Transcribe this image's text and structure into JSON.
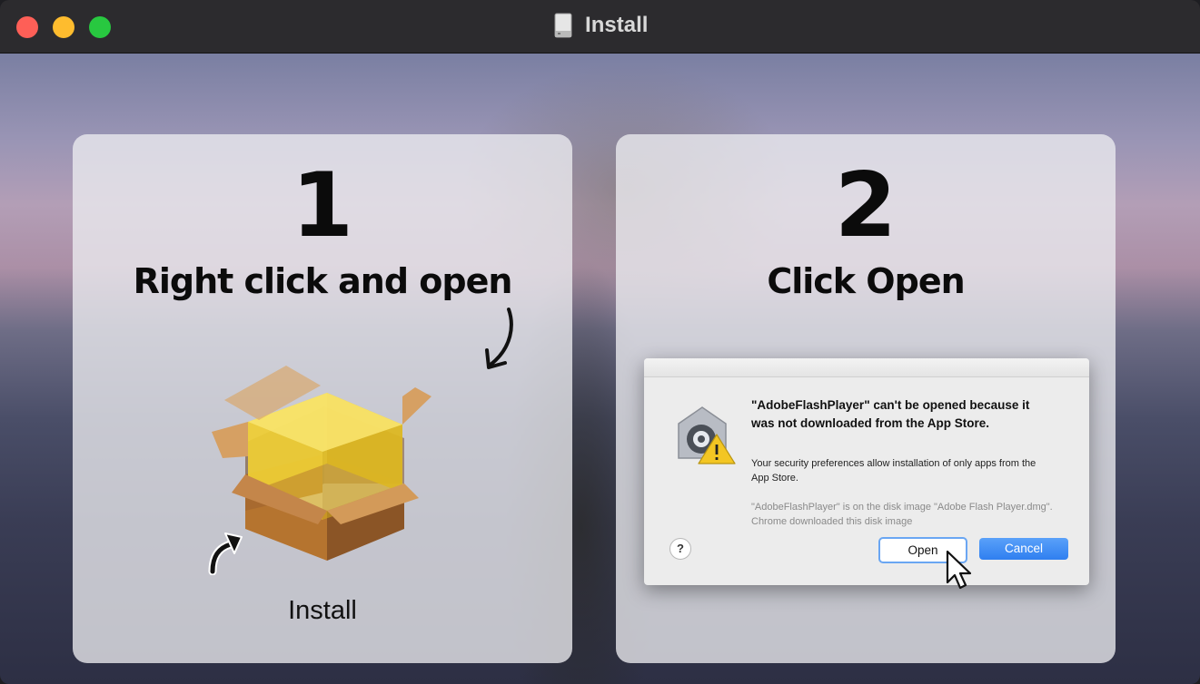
{
  "window": {
    "title": "Install"
  },
  "steps": [
    {
      "number": "1",
      "heading": "Right click and open",
      "icon_label": "Install"
    },
    {
      "number": "2",
      "heading": "Click Open"
    }
  ],
  "dialog": {
    "title": "\"AdobeFlashPlayer\" can't be opened because it was not downloaded from the App Store.",
    "body": "Your security preferences allow installation of only apps from the App Store.",
    "note": "\"AdobeFlashPlayer\" is on the disk image \"Adobe Flash Player.dmg\". Chrome downloaded this disk image",
    "help_label": "?",
    "open_label": "Open",
    "cancel_label": "Cancel"
  },
  "colors": {
    "close": "#fe5f57",
    "minimize": "#febc2e",
    "zoom": "#28c840",
    "titlebar": "#2c2b2e",
    "cancel_button": "#2f7ff0"
  }
}
